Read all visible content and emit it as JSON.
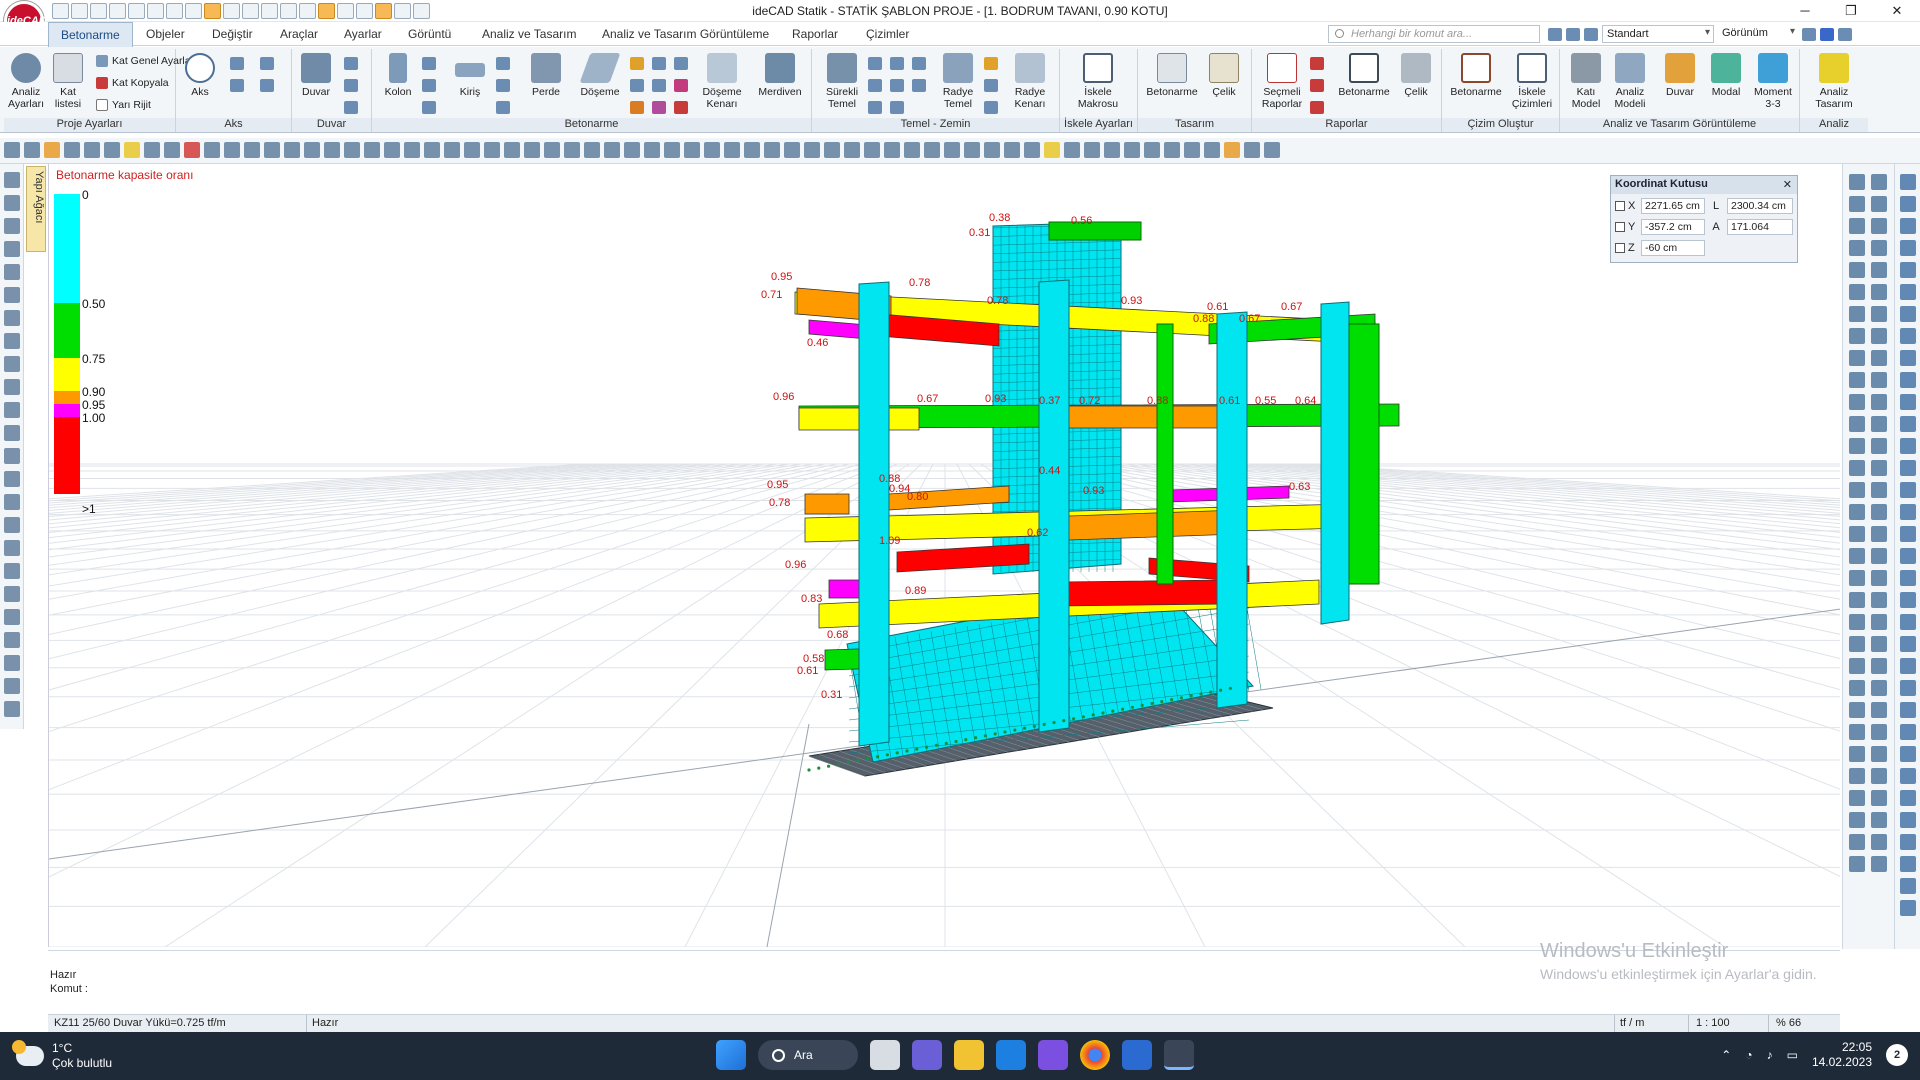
{
  "app": {
    "logo_text": "ideCAD",
    "window_title": "ideCAD Statik - STATİK ŞABLON PROJE - [1. BODRUM TAVANI,  0.90 KOTU]",
    "min_icon": "minimize-icon",
    "max_icon": "maximize-icon",
    "close_icon": "close-icon"
  },
  "menu_tabs": [
    "Betonarme",
    "Objeler",
    "Değiştir",
    "Araçlar",
    "Ayarlar",
    "Görüntü",
    "Analiz ve Tasarım",
    "Analiz ve Tasarım Görüntüleme",
    "Raporlar",
    "Çizimler"
  ],
  "search": {
    "placeholder": "Herhangi bir komut ara..."
  },
  "view_style": {
    "label": "Standart"
  },
  "gorunum_label": "Görünüm",
  "ribbon": {
    "proje_ayarlari": {
      "title": "Proje Ayarları",
      "analiz_ayarlari": "Analiz Ayarları",
      "kat_listesi": "Kat listesi",
      "kat_genel_ayarlari": "Kat Genel Ayarları",
      "kat_kopyala": "Kat Kopyala",
      "yari_rijit": "Yarı Rijit"
    },
    "aks": {
      "title": "Aks",
      "aks": "Aks"
    },
    "duvar": {
      "title": "Duvar",
      "duvar": "Duvar"
    },
    "betonarme": {
      "title": "Betonarme",
      "kolon": "Kolon",
      "kiris": "Kiriş",
      "perde": "Perde",
      "doseme": "Döşeme",
      "doseme_kenari": "Döşeme Kenarı",
      "merdiven": "Merdiven"
    },
    "temel": {
      "title": "Temel - Zemin",
      "surekli_temel": "Sürekli Temel",
      "radye_temel": "Radye Temel",
      "radye_kenari": "Radye Kenarı"
    },
    "iskele_ayarlari": {
      "title": "İskele Ayarları",
      "iskele_makrosu": "İskele Makrosu"
    },
    "tasarim": {
      "title": "Tasarım",
      "betonarme": "Betonarme",
      "celik": "Çelik"
    },
    "raporlar": {
      "title": "Raporlar",
      "secmeli_raporlar": "Seçmeli Raporlar",
      "betonarme": "Betonarme",
      "celik": "Çelik"
    },
    "cizim_olustur": {
      "title": "Çizim Oluştur",
      "betonarme": "Betonarme",
      "iskele_cizimleri": "İskele Çizimleri"
    },
    "atg": {
      "title": "Analiz ve Tasarım Görüntüleme",
      "kati_model": "Katı Model",
      "analiz_modeli": "Analiz Modeli",
      "duvar": "Duvar",
      "modal": "Modal",
      "moment": "Moment 3-3"
    },
    "analiz": {
      "title": "Analiz",
      "analiz_tasarim": "Analiz Tasarım"
    }
  },
  "side_tab": "Yapı Ağacı",
  "legend": {
    "title": "Betonarme kapasite oranı",
    "labels": [
      "0",
      "0.50",
      "0.75",
      "0.90",
      "0.95",
      "1.00",
      ">1"
    ],
    "colors": [
      "#00ffff",
      "#00dd00",
      "#ffff00",
      "#ff9900",
      "#ff00ff",
      "#ff0000"
    ],
    "breaks": [
      0,
      0.5,
      0.75,
      0.9,
      0.95,
      1.0
    ]
  },
  "coord_box": {
    "title": "Koordinat Kutusu",
    "x_label": "X",
    "x_value": "2271.65 cm",
    "y_label": "Y",
    "y_value": "-357.2 cm",
    "z_label": "Z",
    "z_value": "-60 cm",
    "l_label": "L",
    "l_value": "2300.34 cm",
    "a_label": "A",
    "a_value": "171.064"
  },
  "model_labels": [
    "0.38",
    "0.56",
    "0.31",
    "0.95",
    "0.78",
    "0.78",
    "0.93",
    "0.61",
    "0.67",
    "0.71",
    "0.88",
    "0.67",
    "0.46",
    "0.96",
    "0.67",
    "0.93",
    "0.37",
    "0.72",
    "0.88",
    "0.61",
    "0.55",
    "0.64",
    "0.88",
    "0.94",
    "0.44",
    "0.95",
    "0.80",
    "0.93",
    "0.63",
    "0.78",
    "1.09",
    "0.62",
    "0.96",
    "0.89",
    "0.83",
    "0.68",
    "0.61",
    "0.31",
    "0.58"
  ],
  "command": {
    "status": "Hazır",
    "prompt": "Komut :"
  },
  "watermark": {
    "line1": "Windows'u Etkinleştir",
    "line2": "Windows'u etkinleştirmek için Ayarlar'a gidin."
  },
  "statusbar": {
    "info": "KZ11 25/60 Duvar Yükü=0.725 tf/m",
    "state": "Hazır",
    "unit": "tf / m",
    "scale": "1 : 100",
    "zoom": "% 66"
  },
  "taskbar": {
    "temp": "1°C",
    "weather": "Çok bulutlu",
    "search_label": "Ara",
    "time": "22:05",
    "date": "14.02.2023",
    "notifications": "2"
  }
}
